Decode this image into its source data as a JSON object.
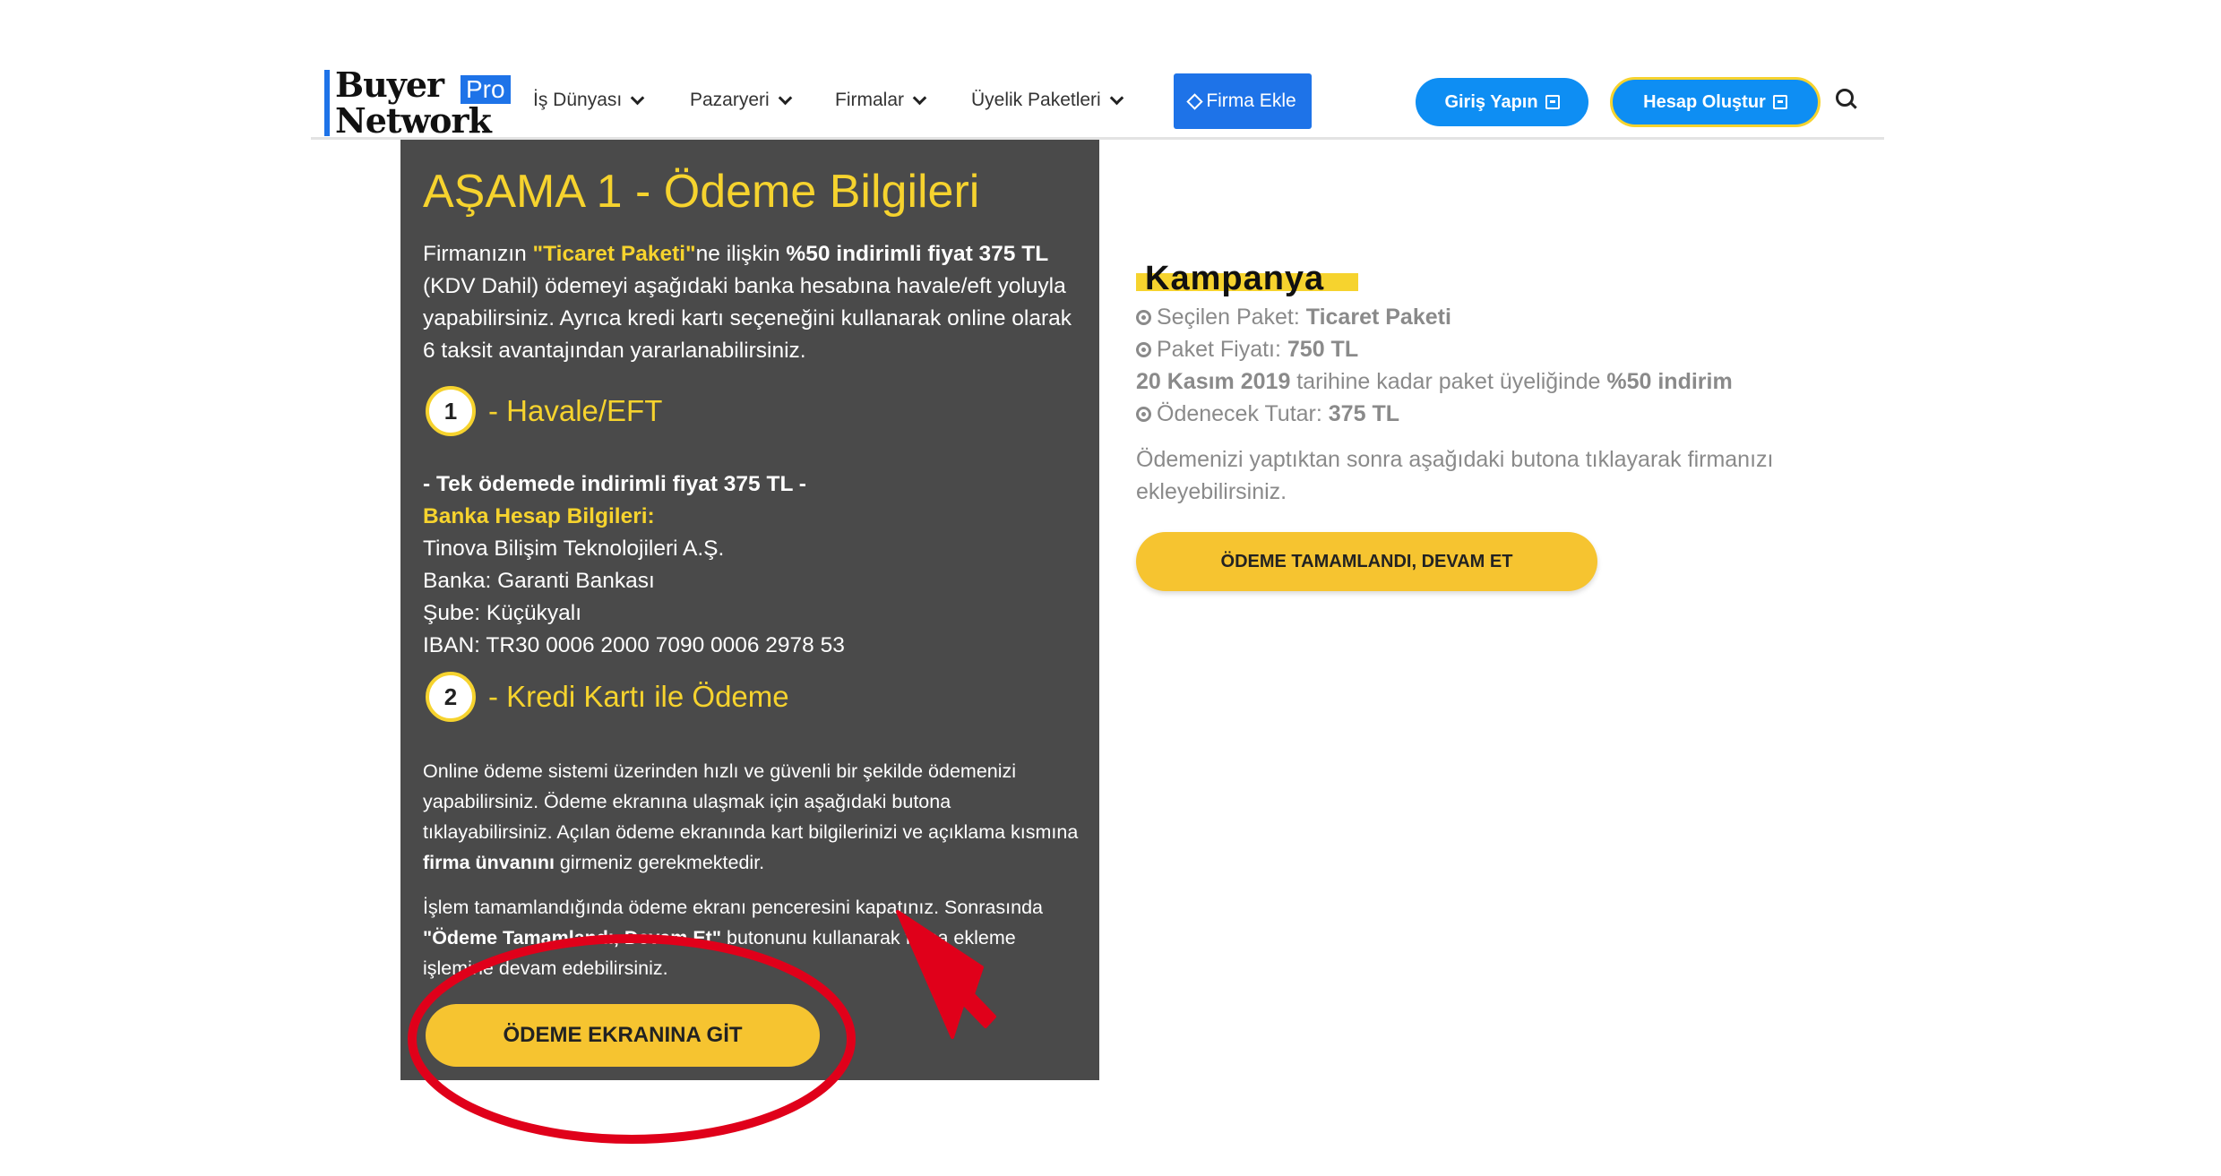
{
  "header": {
    "logo": {
      "buyer": "Buyer",
      "pro": "Pro",
      "network": "Network"
    },
    "nav": [
      {
        "label": "İş Dünyası"
      },
      {
        "label": "Pazaryeri"
      },
      {
        "label": "Firmalar"
      },
      {
        "label": "Üyelik Paketleri"
      }
    ],
    "firma_ekle": "Firma Ekle",
    "login": "Giriş Yapın",
    "signup": "Hesap Oluştur"
  },
  "panel": {
    "title": "AŞAMA 1 - Ödeme Bilgileri",
    "intro": {
      "t1": "Firmanızın ",
      "paket": "\"Ticaret Paketi\"",
      "t2": "ne ilişkin ",
      "price": "%50 indirimli fiyat 375 TL",
      "t3": " (KDV Dahil) ödemeyi aşağıdaki banka hesabına havale/eft yoluyla yapabilirsiniz. Ayrıca kredi kartı seçeneğini kullanarak online olarak 6 taksit avantajından yararlanabilirsiniz."
    },
    "step1": {
      "num": "1",
      "title": "- Havale/EFT"
    },
    "bank": {
      "single": "- Tek ödemede indirimli fiyat 375 TL -",
      "heading": "Banka Hesap Bilgileri:",
      "company": "Tinova Bilişim Teknolojileri A.Ş.",
      "bank": "Banka: Garanti Bankası",
      "branch": "Şube: Küçükyalı",
      "iban": "IBAN: TR30 0006 2000 7090 0006 2978 53"
    },
    "step2": {
      "num": "2",
      "title": "- Kredi Kartı ile Ödeme"
    },
    "online": {
      "p1a": "Online ödeme sistemi üzerinden hızlı ve güvenli bir şekilde ödemenizi yapabilirsiniz. Ödeme ekranına ulaşmak için aşağıdaki butona tıklayabilirsiniz. Açılan ödeme ekranında kart bilgilerinizi ve açıklama kısmına ",
      "p1b": "firma ünvanını",
      "p1c": " girmeniz gerekmektedir.",
      "p2a": "İşlem tamamlandığında ödeme ekranı penceresini kapatınız. Sonrasında ",
      "p2b": "\"Ödeme Tamamlandı, Devam Et\"",
      "p2c": " butonunu kullanarak firma ekleme işlemine devam edebilirsiniz."
    },
    "button": "ÖDEME EKRANINA GİT"
  },
  "campaign": {
    "title": "Kampanya",
    "selected_label": "Seçilen Paket: ",
    "selected_value": "Ticaret Paketi",
    "price_label": "Paket Fiyatı: ",
    "price_value": "750 TL",
    "deadline": "20 Kasım 2019",
    "deadline_text": " tarihine kadar paket üyeliğinde ",
    "discount": "%50 indirim",
    "pay_label": "Ödenecek Tutar: ",
    "pay_value": "375 TL",
    "note": "Ödemenizi yaptıktan sonra aşağıdaki butona tıklayarak firmanızı ekleyebilirsiniz.",
    "button": "ÖDEME TAMAMLANDI, DEVAM ET"
  },
  "colors": {
    "accent_yellow": "#f6d32e",
    "button_yellow": "#f6c430",
    "brand_blue": "#1e73e8",
    "cta_blue": "#0e8ef3",
    "panel_bg": "#4a4a4a",
    "annotation_red": "#e0001a"
  }
}
